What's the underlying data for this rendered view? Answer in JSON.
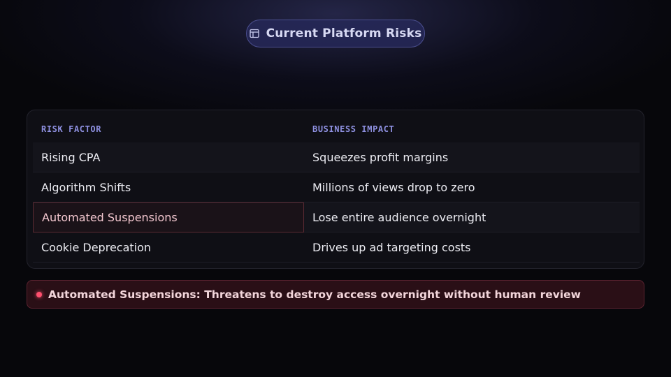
{
  "header": {
    "title": "Current Platform Risks",
    "icon": "table-icon"
  },
  "table": {
    "columns": [
      "RISK FACTOR",
      "BUSINESS IMPACT"
    ],
    "rows": [
      {
        "risk": "Rising CPA",
        "impact": "Squeezes profit margins"
      },
      {
        "risk": "Algorithm Shifts",
        "impact": "Millions of views drop to zero"
      },
      {
        "risk": "Automated Suspensions",
        "impact": "Lose entire audience overnight",
        "highlighted": true
      },
      {
        "risk": "Cookie Deprecation",
        "impact": "Drives up ad targeting costs"
      }
    ]
  },
  "alert": {
    "text": "Automated Suspensions: Threatens to destroy access overnight without human review",
    "icon": "alert-dot-icon"
  },
  "colors": {
    "accent": "#8e90e0",
    "alert": "#ff4f6e",
    "background": "#07070b"
  }
}
